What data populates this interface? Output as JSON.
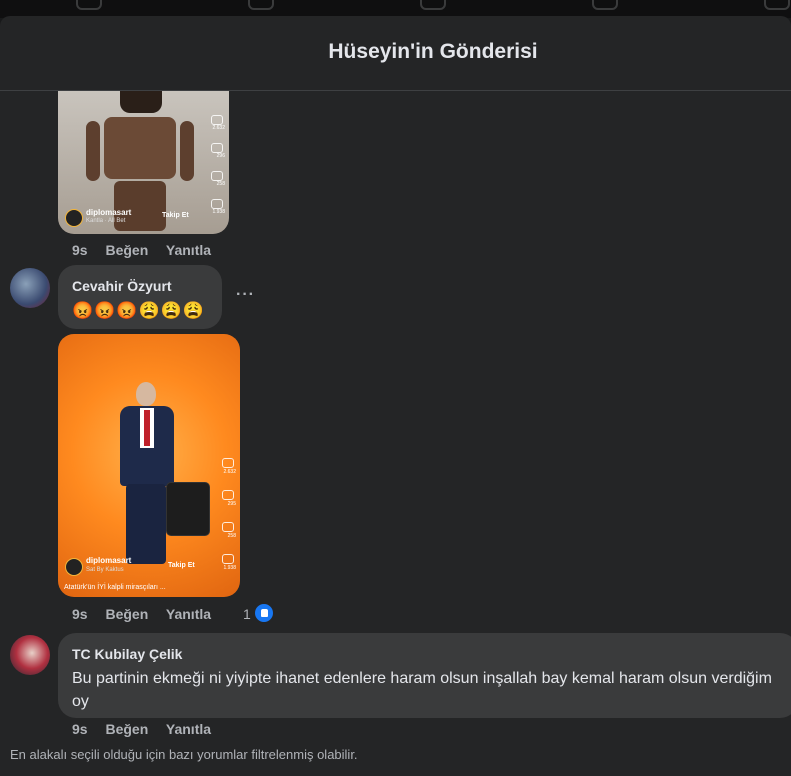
{
  "dialog": {
    "title": "Hüseyin'in Gönderisi"
  },
  "post_media_1": {
    "user": "diplomasart",
    "sub": "Kantla · All Bet",
    "follow_label": "Takip Et",
    "side_counts": [
      "2.632",
      "296",
      "258",
      "1.938"
    ]
  },
  "comment_1": {
    "meta": {
      "time": "9s",
      "like_label": "Beğen",
      "reply_label": "Yanıtla"
    }
  },
  "comment_2": {
    "author": "Cevahir Özyurt",
    "emojis": "😡😡😡😩😩😩",
    "more_label": "···"
  },
  "post_media_2": {
    "user": "diplomasart",
    "sub": "Sat  By Kaktus",
    "follow_label": "Takip Et",
    "side_counts": [
      "2.632",
      "295",
      "258",
      "1.938"
    ],
    "caption": "Atatürk'ün İYİ kalpli mirasçıları ...",
    "meta": {
      "time": "9s",
      "like_label": "Beğen",
      "reply_label": "Yanıtla"
    },
    "reaction_count": "1"
  },
  "comment_3": {
    "author": "TC Kubilay Çelik",
    "text": "Bu partinin ekmeği ni yiyipte ihanet edenlere haram olsun inşallah bay kemal haram olsun verdiğim oy",
    "meta": {
      "time": "9s",
      "like_label": "Beğen",
      "reply_label": "Yanıtla"
    }
  },
  "footer": {
    "note": "En alakalı seçili olduğu için bazı yorumlar filtrelenmiş olabilir."
  },
  "colors": {
    "background": "#18191a",
    "dialog": "#242526",
    "bubble": "#3a3b3c",
    "text": "#e4e6eb",
    "secondary": "#b0b3b8",
    "like_blue": "#1877f2"
  }
}
